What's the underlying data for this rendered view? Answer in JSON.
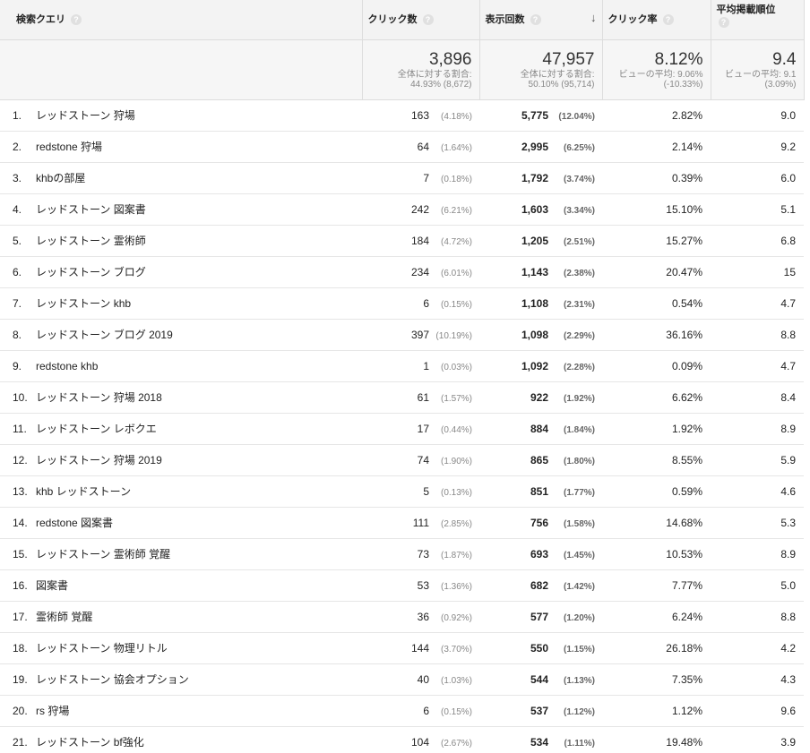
{
  "headers": {
    "query": "検索クエリ",
    "clicks": "クリック数",
    "impressions": "表示回数",
    "ctr": "クリック率",
    "position": "平均掲載順位",
    "help": "?",
    "sort_arrow": "↓"
  },
  "summary": {
    "clicks": {
      "value": "3,896",
      "line1": "全体に対する割合:",
      "line2": "44.93% (8,672)"
    },
    "impressions": {
      "value": "47,957",
      "line1": "全体に対する割合:",
      "line2": "50.10% (95,714)"
    },
    "ctr": {
      "value": "8.12%",
      "line1": "ビューの平均: 9.06%",
      "line2": "(-10.33%)"
    },
    "position": {
      "value": "9.4",
      "line1": "ビューの平均: 9.1",
      "line2": "(3.09%)"
    }
  },
  "rows": [
    {
      "num": "1.",
      "query": "レッドストーン 狩場",
      "clicks": "163",
      "clicks_pct": "(4.18%)",
      "imp": "5,775",
      "imp_pct": "(12.04%)",
      "ctr": "2.82%",
      "pos": "9.0"
    },
    {
      "num": "2.",
      "query": "redstone 狩場",
      "clicks": "64",
      "clicks_pct": "(1.64%)",
      "imp": "2,995",
      "imp_pct": "(6.25%)",
      "ctr": "2.14%",
      "pos": "9.2"
    },
    {
      "num": "3.",
      "query": "khbの部屋",
      "clicks": "7",
      "clicks_pct": "(0.18%)",
      "imp": "1,792",
      "imp_pct": "(3.74%)",
      "ctr": "0.39%",
      "pos": "6.0"
    },
    {
      "num": "4.",
      "query": "レッドストーン 図案書",
      "clicks": "242",
      "clicks_pct": "(6.21%)",
      "imp": "1,603",
      "imp_pct": "(3.34%)",
      "ctr": "15.10%",
      "pos": "5.1"
    },
    {
      "num": "5.",
      "query": "レッドストーン 霊術師",
      "clicks": "184",
      "clicks_pct": "(4.72%)",
      "imp": "1,205",
      "imp_pct": "(2.51%)",
      "ctr": "15.27%",
      "pos": "6.8"
    },
    {
      "num": "6.",
      "query": "レッドストーン ブログ",
      "clicks": "234",
      "clicks_pct": "(6.01%)",
      "imp": "1,143",
      "imp_pct": "(2.38%)",
      "ctr": "20.47%",
      "pos": "15"
    },
    {
      "num": "7.",
      "query": "レッドストーン khb",
      "clicks": "6",
      "clicks_pct": "(0.15%)",
      "imp": "1,108",
      "imp_pct": "(2.31%)",
      "ctr": "0.54%",
      "pos": "4.7"
    },
    {
      "num": "8.",
      "query": "レッドストーン ブログ 2019",
      "clicks": "397",
      "clicks_pct": "(10.19%)",
      "imp": "1,098",
      "imp_pct": "(2.29%)",
      "ctr": "36.16%",
      "pos": "8.8"
    },
    {
      "num": "9.",
      "query": "redstone khb",
      "clicks": "1",
      "clicks_pct": "(0.03%)",
      "imp": "1,092",
      "imp_pct": "(2.28%)",
      "ctr": "0.09%",
      "pos": "4.7"
    },
    {
      "num": "10.",
      "query": "レッドストーン 狩場 2018",
      "clicks": "61",
      "clicks_pct": "(1.57%)",
      "imp": "922",
      "imp_pct": "(1.92%)",
      "ctr": "6.62%",
      "pos": "8.4"
    },
    {
      "num": "11.",
      "query": "レッドストーン レボクエ",
      "clicks": "17",
      "clicks_pct": "(0.44%)",
      "imp": "884",
      "imp_pct": "(1.84%)",
      "ctr": "1.92%",
      "pos": "8.9"
    },
    {
      "num": "12.",
      "query": "レッドストーン 狩場 2019",
      "clicks": "74",
      "clicks_pct": "(1.90%)",
      "imp": "865",
      "imp_pct": "(1.80%)",
      "ctr": "8.55%",
      "pos": "5.9"
    },
    {
      "num": "13.",
      "query": "khb レッドストーン",
      "clicks": "5",
      "clicks_pct": "(0.13%)",
      "imp": "851",
      "imp_pct": "(1.77%)",
      "ctr": "0.59%",
      "pos": "4.6"
    },
    {
      "num": "14.",
      "query": "redstone 図案書",
      "clicks": "111",
      "clicks_pct": "(2.85%)",
      "imp": "756",
      "imp_pct": "(1.58%)",
      "ctr": "14.68%",
      "pos": "5.3"
    },
    {
      "num": "15.",
      "query": "レッドストーン 霊術師 覚醒",
      "clicks": "73",
      "clicks_pct": "(1.87%)",
      "imp": "693",
      "imp_pct": "(1.45%)",
      "ctr": "10.53%",
      "pos": "8.9"
    },
    {
      "num": "16.",
      "query": "図案書",
      "clicks": "53",
      "clicks_pct": "(1.36%)",
      "imp": "682",
      "imp_pct": "(1.42%)",
      "ctr": "7.77%",
      "pos": "5.0"
    },
    {
      "num": "17.",
      "query": "霊術師 覚醒",
      "clicks": "36",
      "clicks_pct": "(0.92%)",
      "imp": "577",
      "imp_pct": "(1.20%)",
      "ctr": "6.24%",
      "pos": "8.8"
    },
    {
      "num": "18.",
      "query": "レッドストーン 物理リトル",
      "clicks": "144",
      "clicks_pct": "(3.70%)",
      "imp": "550",
      "imp_pct": "(1.15%)",
      "ctr": "26.18%",
      "pos": "4.2"
    },
    {
      "num": "19.",
      "query": "レッドストーン 協会オプション",
      "clicks": "40",
      "clicks_pct": "(1.03%)",
      "imp": "544",
      "imp_pct": "(1.13%)",
      "ctr": "7.35%",
      "pos": "4.3"
    },
    {
      "num": "20.",
      "query": "rs 狩場",
      "clicks": "6",
      "clicks_pct": "(0.15%)",
      "imp": "537",
      "imp_pct": "(1.12%)",
      "ctr": "1.12%",
      "pos": "9.6"
    },
    {
      "num": "21.",
      "query": "レッドストーン bf強化",
      "clicks": "104",
      "clicks_pct": "(2.67%)",
      "imp": "534",
      "imp_pct": "(1.11%)",
      "ctr": "19.48%",
      "pos": "3.9"
    }
  ]
}
